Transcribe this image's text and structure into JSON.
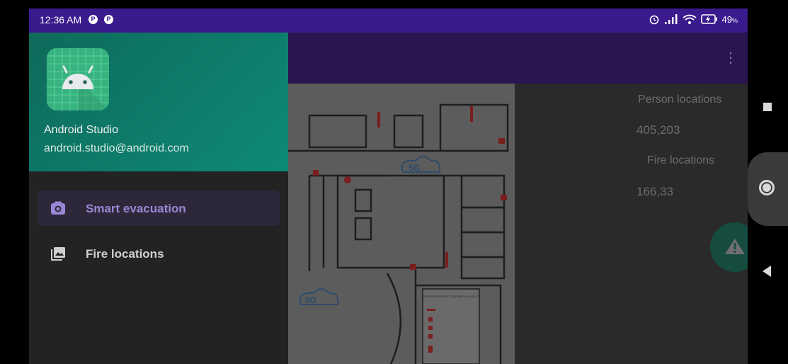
{
  "status_bar": {
    "time": "12:36 AM",
    "app_icon_glyph": "P",
    "battery": "49",
    "battery_unit": "%"
  },
  "drawer": {
    "app_name": "Android Studio",
    "email": "android.studio@android.com",
    "items": [
      {
        "label": "Smart evacuation",
        "icon": "camera-icon",
        "selected": true
      },
      {
        "label": "Fire locations",
        "icon": "gallery-icon",
        "selected": false
      }
    ]
  },
  "right_panel": {
    "person_locations_label": "Person locations",
    "person_locations_value": "405,203",
    "fire_locations_label": "Fire locations",
    "fire_locations_value": "166,33"
  },
  "floorplan": {
    "network_labels": [
      "5G",
      "5G"
    ],
    "legend_title": "EMERGENCY EXIT & SECURITY LAYOUT"
  },
  "colors": {
    "status_bar": "#3a1a8c",
    "app_bar": "#2a1550",
    "drawer_header": "#0f6a5a",
    "selected_accent": "#9b86d6",
    "fab": "#164b40"
  }
}
